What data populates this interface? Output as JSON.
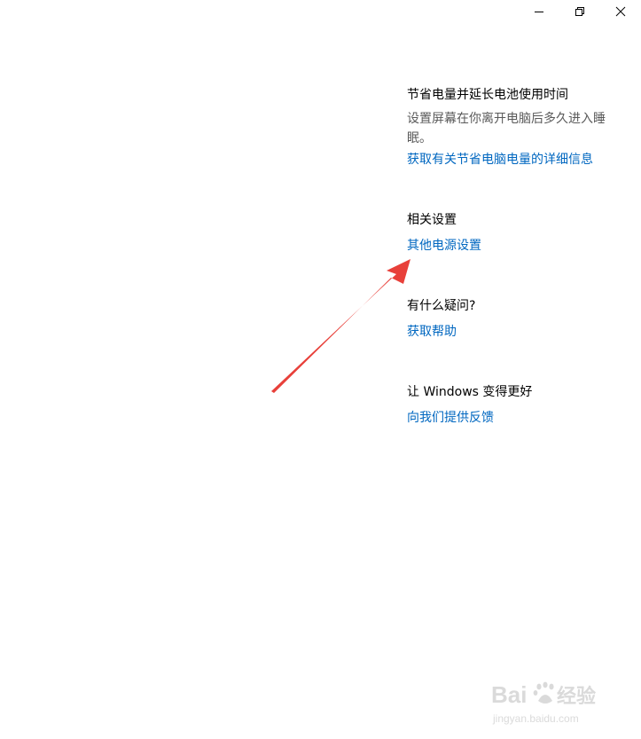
{
  "window": {
    "controls": {
      "minimize_icon": "minimize-icon",
      "restore_icon": "restore-icon",
      "close_icon": "close-icon"
    }
  },
  "sidebar_panel": {
    "battery_section": {
      "title": "节省电量并延长电池使用时间",
      "description": "设置屏幕在你离开电脑后多久进入睡眠。",
      "link": "获取有关节省电脑电量的详细信息"
    },
    "related_section": {
      "title": "相关设置",
      "link": "其他电源设置"
    },
    "help_section": {
      "title": "有什么疑问?",
      "link": "获取帮助"
    },
    "feedback_section": {
      "title": "让 Windows 变得更好",
      "link": "向我们提供反馈"
    }
  },
  "annotation": {
    "arrow_color": "#e8403a"
  },
  "colors": {
    "link": "#0067c0",
    "description": "#5a5a5a",
    "title": "#000000"
  },
  "watermark": {
    "brand": "Bai",
    "brand_suffix": "经验",
    "url": "jingyan.baidu.com"
  }
}
